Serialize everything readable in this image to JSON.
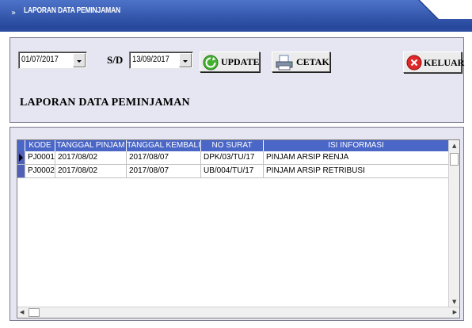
{
  "window": {
    "title": "LAPORAN DATA PEMINJAMAN",
    "title_icon": "chevron-down-double-icon"
  },
  "filter": {
    "date_from": "01/07/2017",
    "separator_label": "S/D",
    "date_to": "13/09/2017"
  },
  "toolbar": {
    "update_label": "UPDATE",
    "print_label": "CETAK",
    "exit_label": "KELUAR"
  },
  "report": {
    "heading": "LAPORAN DATA PEMINJAMAN"
  },
  "grid": {
    "columns": [
      "KODE",
      "TANGGAL PINJAM",
      "TANGGAL KEMBALI",
      "NO SURAT",
      "ISI INFORMASI"
    ],
    "rows": [
      [
        "PJ0001",
        "2017/08/02",
        "2017/08/07",
        "DPK/03/TU/17",
        "PINJAM ARSIP RENJA"
      ],
      [
        "PJ0002",
        "2017/08/02",
        "2017/08/07",
        "UB/004/TU/17",
        "PINJAM ARSIP RETRIBUSI"
      ]
    ],
    "current_row": 0
  },
  "colors": {
    "title_bar": "#3055a8",
    "grid_header": "#4a66c6",
    "panel": "#e6e6f2"
  }
}
